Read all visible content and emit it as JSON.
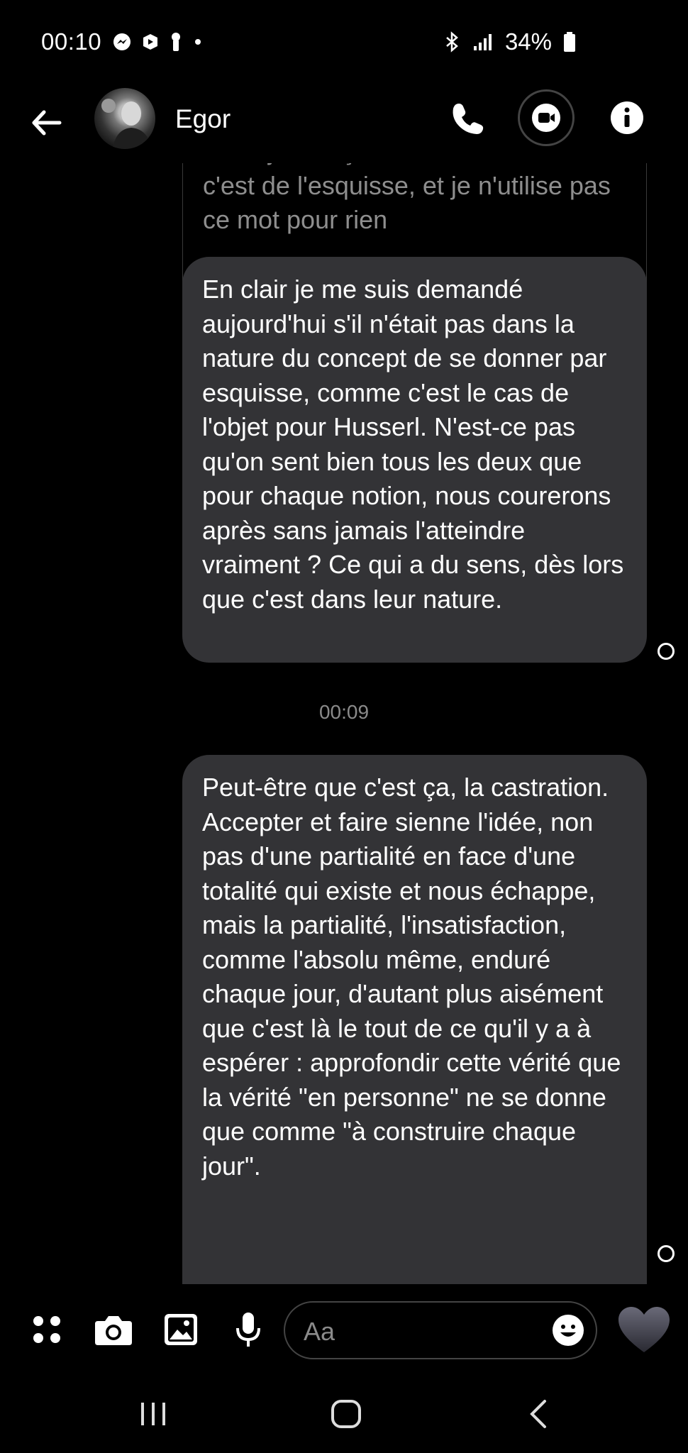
{
  "status_bar": {
    "time": "00:10",
    "battery": "34%",
    "icons": [
      "messenger-icon",
      "apps-icon",
      "keyhole-icon",
      "dot-icon",
      "bluetooth-icon",
      "signal-icon",
      "battery-icon"
    ]
  },
  "header": {
    "contact_name": "Egor"
  },
  "messages": {
    "partial_reply": "Enfin je fais ça à la vas-vite hein, c'est de l'esquisse, et je n'utilise pas ce mot pour rien",
    "message_1": "En clair je me suis demandé aujourd'hui s'il n'était pas dans la nature du concept de se donner par esquisse, comme c'est le cas de l'objet pour Husserl. N'est-ce pas qu'on sent bien tous les deux que pour chaque notion, nous courerons après sans jamais l'atteindre vraiment ? Ce qui a du sens, dès lors que c'est dans leur nature.",
    "timestamp": "00:09",
    "message_2": "Peut-être que c'est ça, la castration. Accepter et faire sienne l'idée, non pas d'une partialité en face d'une totalité qui existe et nous échappe, mais la partialité, l'insatisfaction, comme l'absolu même, enduré chaque jour, d'autant plus aisément que c'est là le tout de ce qu'il y a à espérer : approfondir cette vérité que la vérité \"en personne\" ne se donne que comme \"à construire chaque jour\"."
  },
  "composer": {
    "placeholder": "Aa"
  },
  "colors": {
    "background": "#000000",
    "bubble": "#333336",
    "accent": "#ffffff"
  }
}
